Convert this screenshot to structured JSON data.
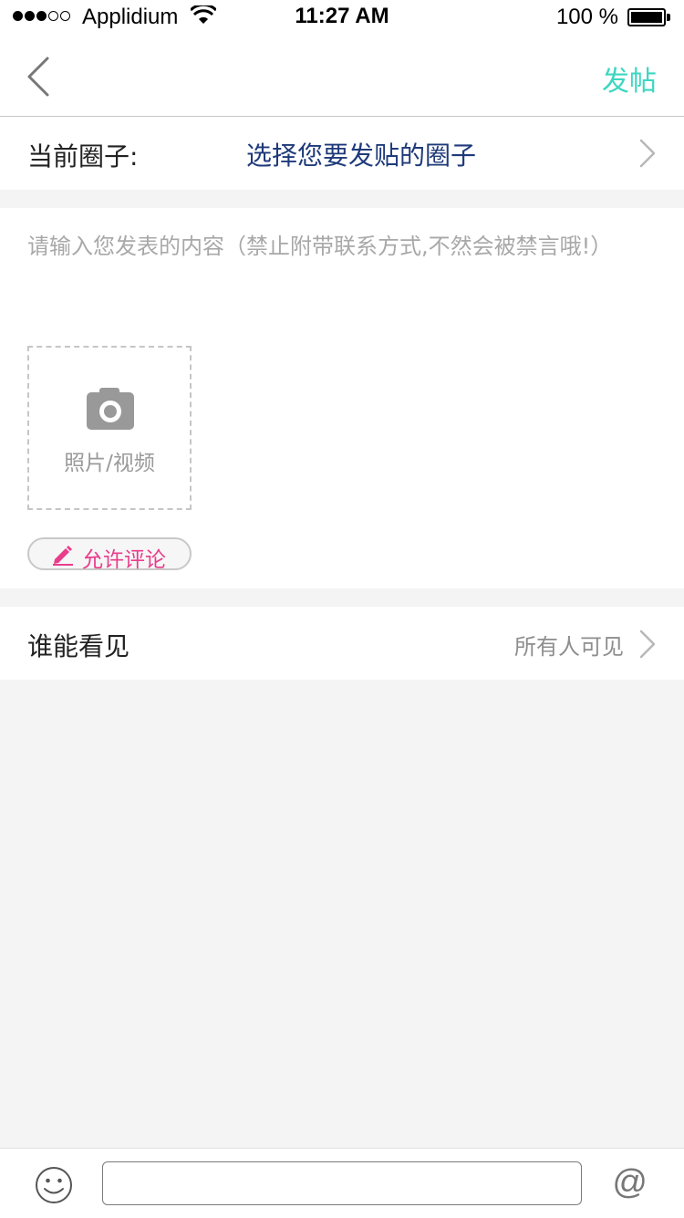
{
  "status_bar": {
    "carrier": "Applidium",
    "time": "11:27 AM",
    "battery": "100 %",
    "signal_bars_filled": 3,
    "signal_bars_total": 5
  },
  "nav": {
    "back_icon": "chevron-left-icon",
    "post_label": "发帖"
  },
  "circle": {
    "label": "当前圈子:",
    "value": "选择您要发贴的圈子"
  },
  "content": {
    "placeholder": "请输入您发表的内容（禁止附带联系方式,不然会被禁言哦!）",
    "upload_label": "照片/视频",
    "comment_toggle_label": "允许评论"
  },
  "visibility": {
    "label": "谁能看见",
    "value": "所有人可见"
  },
  "bottom_bar": {
    "emoji_icon": "smiley-icon",
    "message_value": "",
    "at_symbol": "@"
  },
  "colors": {
    "accent": "#3dd6c0",
    "link": "#1f3a7a",
    "comment": "#e93d8c",
    "background": "#f4f4f4"
  }
}
